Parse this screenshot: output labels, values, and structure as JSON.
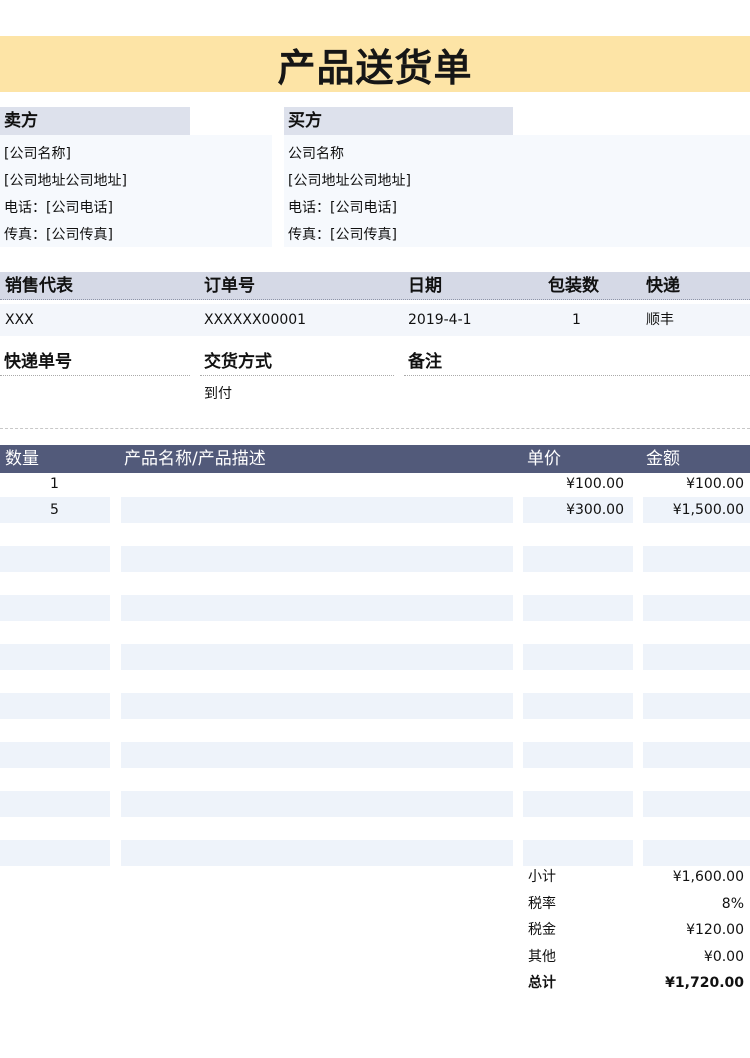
{
  "title": "产品送货单",
  "seller": {
    "heading": "卖方",
    "name": "[公司名称]",
    "address": "[公司地址公司地址]",
    "phone": "电话：[公司电话]",
    "fax": "传真：[公司传真]"
  },
  "buyer": {
    "heading": "买方",
    "name": "公司名称",
    "address": "[公司地址公司地址]",
    "phone": "电话：[公司电话]",
    "fax": "传真：[公司传真]"
  },
  "order": {
    "headers": [
      "销售代表",
      "订单号",
      "日期",
      "包装数",
      "快递"
    ],
    "values": [
      "XXX",
      "XXXXXX00001",
      "2019-4-1",
      "1",
      "顺丰"
    ]
  },
  "shipping": {
    "headers": [
      "快递单号",
      "交货方式",
      "备注"
    ],
    "values": [
      "",
      "到付",
      ""
    ]
  },
  "items": {
    "headers": [
      "数量",
      "产品名称/产品描述",
      "单价",
      "金额"
    ],
    "rows": [
      {
        "qty": "1",
        "desc": "",
        "price": "¥100.00",
        "amount": "¥100.00"
      },
      {
        "qty": "5",
        "desc": "",
        "price": "¥300.00",
        "amount": "¥1,500.00"
      }
    ]
  },
  "summary": [
    {
      "label": "小计",
      "value": "¥1,600.00"
    },
    {
      "label": "税率",
      "value": "8%"
    },
    {
      "label": "税金",
      "value": "¥120.00"
    },
    {
      "label": "其他",
      "value": "¥0.00"
    },
    {
      "label": "总计",
      "value": "¥1,720.00"
    }
  ],
  "colors": {
    "title_band": "#fde4a6",
    "table_header": "#525a7a",
    "row_stripe": "#eef3fa"
  }
}
